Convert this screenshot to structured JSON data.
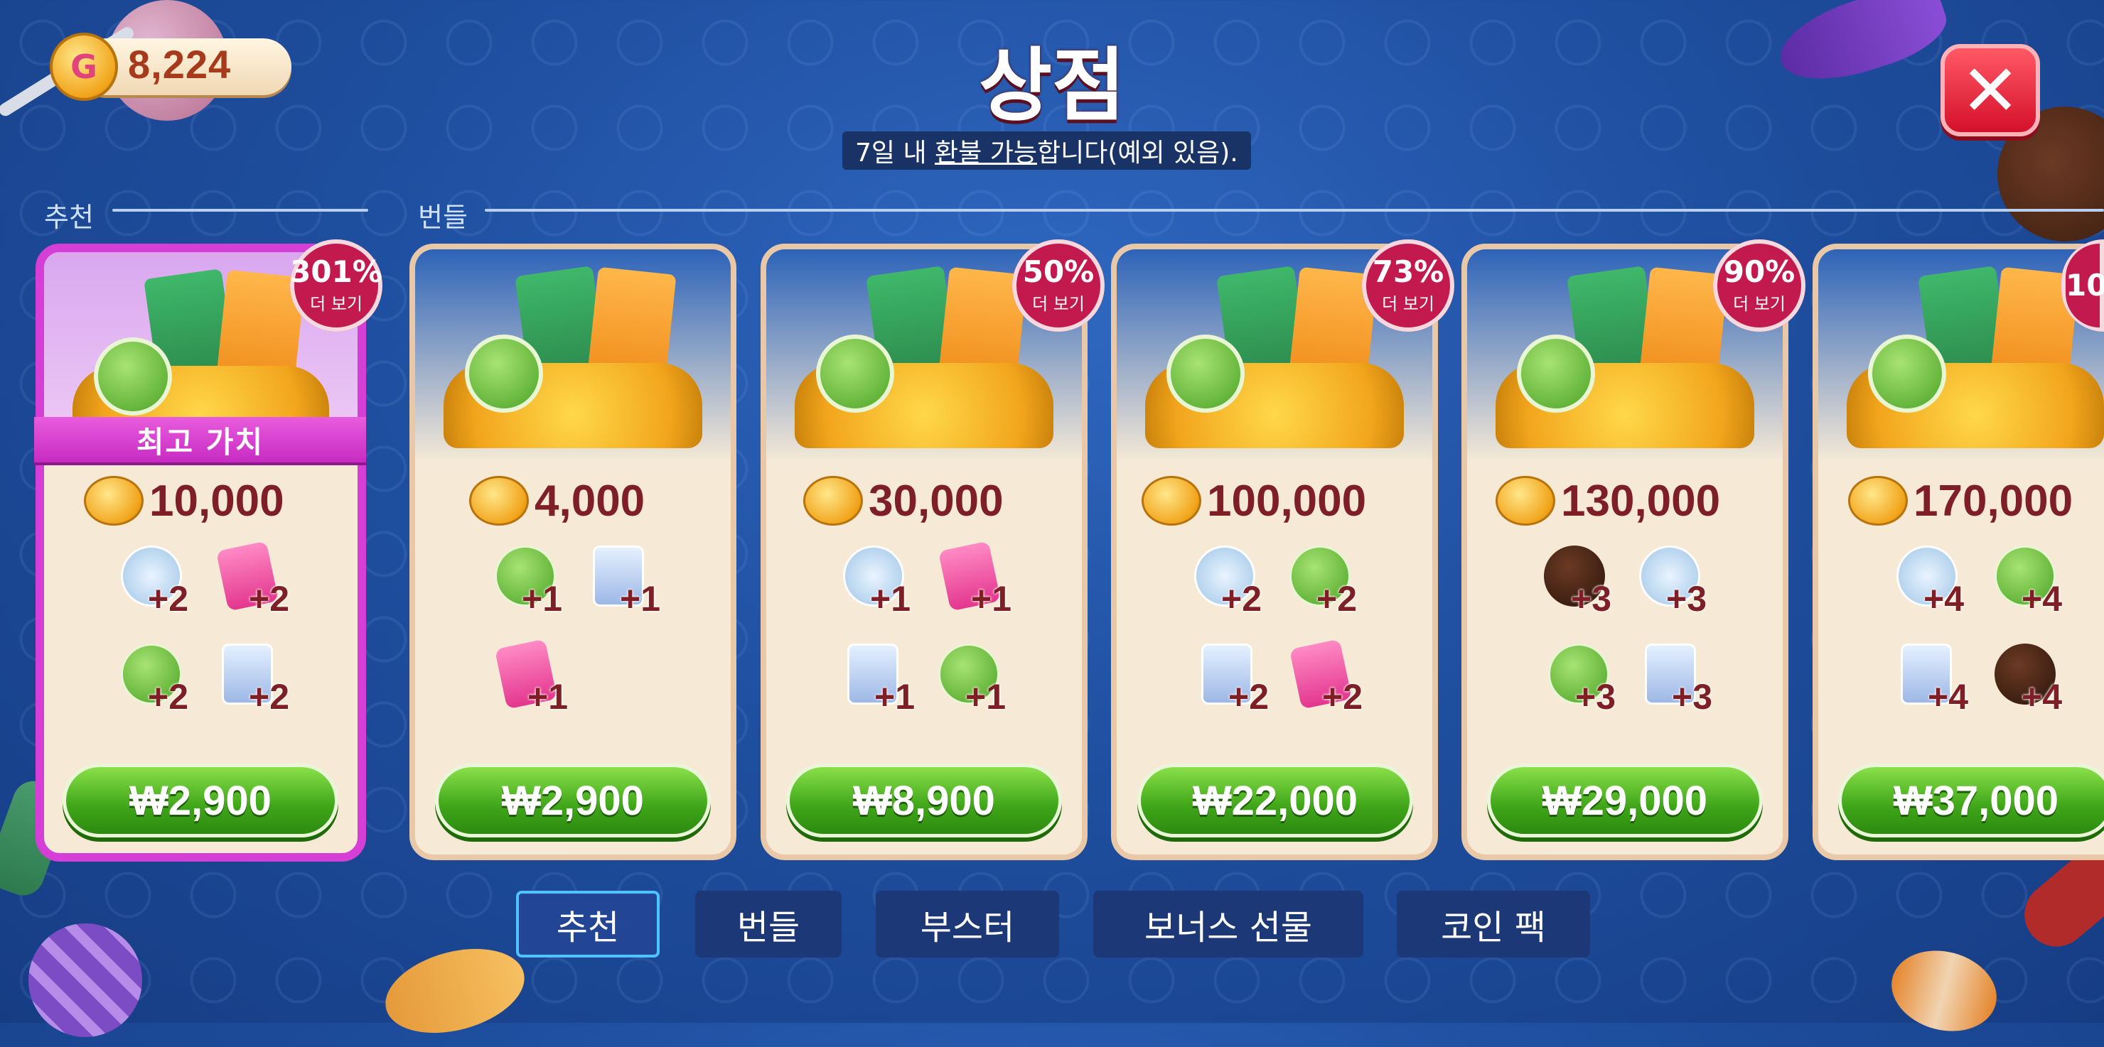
{
  "header": {
    "coin_symbol": "G",
    "coin_balance": "8,224",
    "title": "상점",
    "refund_prefix": "7일 내 ",
    "refund_link": "환불 가능",
    "refund_suffix": "합니다(예외 있음).",
    "close_icon": "✕"
  },
  "sections": {
    "recommended_label": "추천",
    "bundles_label": "번들"
  },
  "best_ribbon": "최고 가치",
  "cards": [
    {
      "badge_pct": "301%",
      "badge_more": "더 보기",
      "coins": "10,000",
      "items": [
        {
          "icon": "cards-icon",
          "qty": "+2"
        },
        {
          "icon": "ticket-icon",
          "qty": "+2"
        },
        {
          "icon": "undo-icon",
          "qty": "+2"
        },
        {
          "icon": "fish-card-icon",
          "qty": "+2"
        }
      ],
      "price": "₩2,900"
    },
    {
      "coins": "4,000",
      "items": [
        {
          "icon": "undo-icon",
          "qty": "+1"
        },
        {
          "icon": "fish-card-icon",
          "qty": "+1"
        },
        {
          "icon": "ticket-icon",
          "qty": "+1"
        }
      ],
      "price": "₩2,900"
    },
    {
      "badge_pct": "50%",
      "badge_more": "더 보기",
      "coins": "30,000",
      "items": [
        {
          "icon": "cards-icon",
          "qty": "+1"
        },
        {
          "icon": "ticket-icon",
          "qty": "+1"
        },
        {
          "icon": "fish-card-icon",
          "qty": "+1"
        },
        {
          "icon": "undo-icon",
          "qty": "+1"
        }
      ],
      "price": "₩8,900"
    },
    {
      "badge_pct": "73%",
      "badge_more": "더 보기",
      "coins": "100,000",
      "items": [
        {
          "icon": "cards-icon",
          "qty": "+2"
        },
        {
          "icon": "undo-icon",
          "qty": "+2"
        },
        {
          "icon": "fish-card-icon",
          "qty": "+2"
        },
        {
          "icon": "ticket-icon",
          "qty": "+2"
        }
      ],
      "price": "₩22,000"
    },
    {
      "badge_pct": "90%",
      "badge_more": "더 보기",
      "coins": "130,000",
      "items": [
        {
          "icon": "candy-icon",
          "qty": "+3"
        },
        {
          "icon": "cards-icon",
          "qty": "+3"
        },
        {
          "icon": "undo-icon",
          "qty": "+3"
        },
        {
          "icon": "fish-card-icon",
          "qty": "+3"
        }
      ],
      "price": "₩29,000"
    },
    {
      "badge_pct": "10",
      "coins": "170,000",
      "items": [
        {
          "icon": "cards-icon",
          "qty": "+4"
        },
        {
          "icon": "undo-icon",
          "qty": "+4"
        },
        {
          "icon": "fish-card-icon",
          "qty": "+4"
        },
        {
          "icon": "candy-icon",
          "qty": "+4"
        }
      ],
      "price": "₩37,000"
    }
  ],
  "tabs": [
    "추천",
    "번들",
    "부스터",
    "보너스 선물",
    "코인 팩"
  ],
  "colors": {
    "background": "#1f4fa0",
    "badge": "#c2194e",
    "price_button": "#3ea518",
    "best_border": "#d53fd6",
    "active_tab_border": "#4fc3ff"
  }
}
